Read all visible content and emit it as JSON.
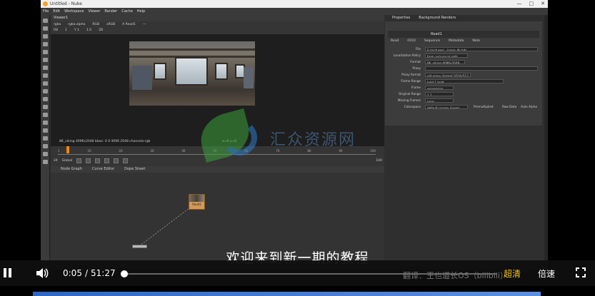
{
  "app": {
    "title": "Untitled - Nuke",
    "menu": [
      "File",
      "Edit",
      "Workspace",
      "Viewer",
      "Render",
      "Cache",
      "Help"
    ],
    "window_buttons": [
      "—",
      "□",
      "✕"
    ]
  },
  "viewer": {
    "tab": "Viewer1",
    "ctrl_row1": [
      "rgba",
      "rgba.alpha",
      "RGB",
      "sRGB",
      "A  Read1",
      "—"
    ],
    "ctrl_row2": [
      "f/8",
      "1",
      "Y 1",
      "1.0",
      "2D"
    ],
    "status": "8K_viking 4096x2048  bbox: 0 0 4096 2048 channels:rgb",
    "coords": "x=0 y=0"
  },
  "timeline": {
    "ticks": [
      "1",
      "10",
      "20",
      "30",
      "40",
      "50",
      "60",
      "70",
      "80",
      "90",
      "100"
    ],
    "fps_label": "24",
    "mode_label": "Global",
    "frame": "100"
  },
  "nodegraph": {
    "tabs": [
      "Node Graph",
      "Curve Editor",
      "Dope Sheet"
    ],
    "read_node_label": "Read1"
  },
  "properties": {
    "tabs": [
      "Properties",
      "Background Renders"
    ],
    "node_name": "Read1",
    "subtabs": [
      "Read",
      "OCIO",
      "Sequence",
      "Metadata",
      "Note"
    ],
    "rows": [
      {
        "label": "File",
        "value": "E:/pictures/.../pano_4k.hdr"
      },
      {
        "label": "Localization Policy",
        "value": "from auto-local path"
      },
      {
        "label": "Format",
        "value": "8K_viking 4096x2048"
      },
      {
        "label": "Proxy",
        "value": ""
      },
      {
        "label": "Proxy format",
        "value": "vid proxy_format 1024x512"
      },
      {
        "label": "Frame Range",
        "value": "hold    1   hold"
      },
      {
        "label": "Frame",
        "value": "expression"
      },
      {
        "label": "Original Range",
        "value": "1     1"
      },
      {
        "label": "Missing Frames",
        "value": "error"
      },
      {
        "label": "Colorspace",
        "value": "default (scene_linear)"
      }
    ],
    "extra_flags": [
      "Premultiplied",
      "Raw Data",
      "Auto Alpha"
    ]
  },
  "watermark": {
    "text": "汇众资源网"
  },
  "player": {
    "subtitle": "欢迎来到新一期的教程",
    "current_time": "0:05",
    "separator": "/",
    "duration": "51:27",
    "progress": 0.0016,
    "danmaku_text": "翻译：王也道长OS（bilibili）",
    "quality_label": "超清",
    "speed_label": "倍速",
    "colors": {
      "quality": "#f5c518",
      "accent": "#ffffff"
    }
  }
}
